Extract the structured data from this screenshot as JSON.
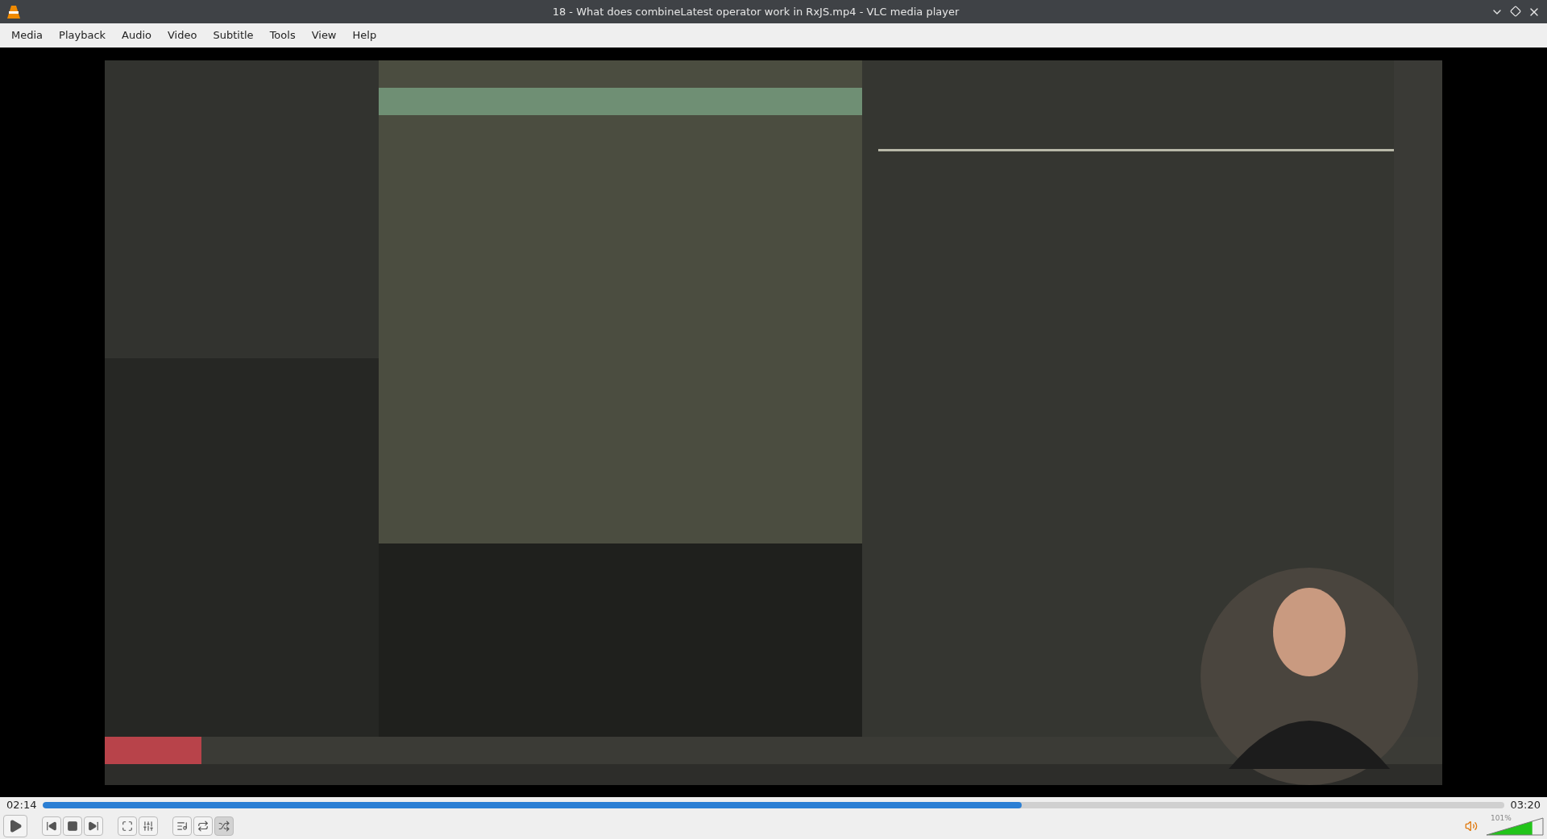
{
  "window": {
    "title": "18 - What does combineLatest operator work in RxJS.mp4 - VLC media player"
  },
  "menu": [
    "Media",
    "Playback",
    "Audio",
    "Video",
    "Subtitle",
    "Tools",
    "View",
    "Help"
  ],
  "video": {
    "kind": "picture"
  },
  "seek": {
    "elapsed": "02:14",
    "total": "03:20",
    "level": 0.67
  },
  "controls": [
    {
      "kind": "play",
      "on": false
    },
    {
      "kind": "prev",
      "on": false
    },
    {
      "kind": "stop",
      "on": false
    },
    {
      "kind": "next",
      "on": false
    },
    {
      "kind": "fullscreen",
      "on": false
    },
    {
      "kind": "settings",
      "on": false
    },
    {
      "kind": "playlist",
      "on": false
    },
    {
      "kind": "loop",
      "on": false
    },
    {
      "kind": "shuffle",
      "on": true
    }
  ],
  "volume": {
    "reading": "101%",
    "level": 0.81
  }
}
